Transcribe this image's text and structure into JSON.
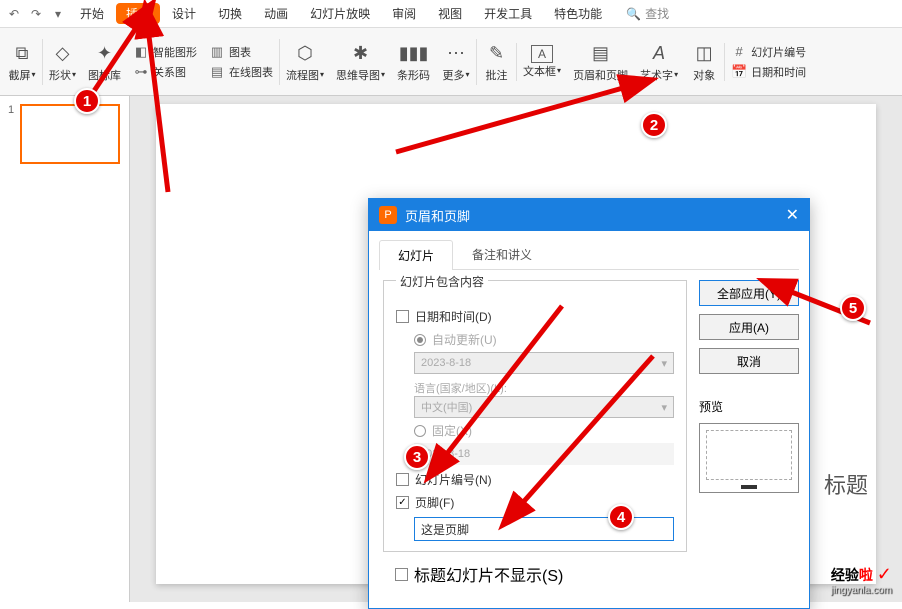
{
  "menu": {
    "start": "开始",
    "insert": "插入",
    "design": "设计",
    "transition": "切换",
    "animation": "动画",
    "slideshow": "幻灯片放映",
    "review": "审阅",
    "view": "视图",
    "devtools": "开发工具",
    "special": "特色功能",
    "search": "查找"
  },
  "ribbon": {
    "screenshot": "截屏",
    "shapes": "形状",
    "icon_lib": "图标库",
    "smartart": "智能图形",
    "chart": "图表",
    "relation": "关系图",
    "online_chart": "在线图表",
    "flowchart": "流程图",
    "mindmap": "思维导图",
    "barcode": "条形码",
    "more": "更多",
    "comment": "批注",
    "textbox": "文本框",
    "header_footer": "页眉和页脚",
    "wordart": "艺术字",
    "object": "对象",
    "slide_number": "幻灯片编号",
    "datetime": "日期和时间"
  },
  "dialog": {
    "title": "页眉和页脚",
    "tab_slide": "幻灯片",
    "tab_notes": "备注和讲义",
    "group_title": "幻灯片包含内容",
    "datetime": "日期和时间(D)",
    "auto_update": "自动更新(U)",
    "date_value": "2023-8-18",
    "lang_label": "语言(国家/地区)(L):",
    "lang_value": "中文(中国)",
    "fixed": "固定(X)",
    "fixed_value": "2023-8-18",
    "slide_number": "幻灯片编号(N)",
    "footer": "页脚(F)",
    "footer_value": "这是页脚",
    "hide_title": "标题幻灯片不显示(S)",
    "apply_all": "全部应用(Y)",
    "apply": "应用(A)",
    "cancel": "取消",
    "preview": "预览"
  },
  "slide": {
    "title_placeholder": "标题"
  },
  "annotations": {
    "n1": "1",
    "n2": "2",
    "n3": "3",
    "n4": "4",
    "n5": "5"
  },
  "watermark": {
    "main": "经验",
    "la": "啦",
    "url": "jingyanla.com"
  }
}
